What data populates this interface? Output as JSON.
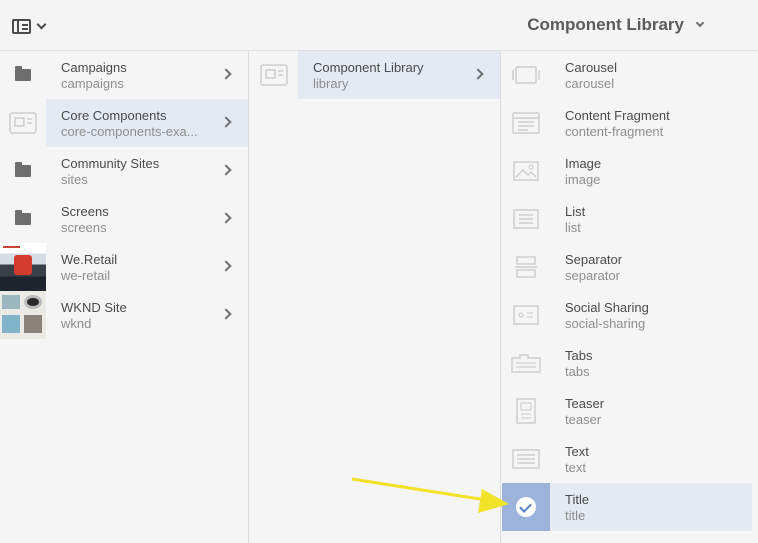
{
  "header": {
    "title": "Component Library",
    "rail_toggle_icon": "rail-toggle-icon",
    "title_menu_icon": "chevron-down-icon"
  },
  "columns": {
    "sites": [
      {
        "title": "Campaigns",
        "name": "campaigns",
        "thumb": "folder-icon",
        "selected": false
      },
      {
        "title": "Core Components",
        "name": "core-components-exa...",
        "thumb": "component-icon",
        "selected": true
      },
      {
        "title": "Community Sites",
        "name": "sites",
        "thumb": "folder-icon",
        "selected": false
      },
      {
        "title": "Screens",
        "name": "screens",
        "thumb": "folder-icon",
        "selected": false
      },
      {
        "title": "We.Retail",
        "name": "we-retail",
        "thumb": "we-retail-thumbnail",
        "selected": false
      },
      {
        "title": "WKND Site",
        "name": "wknd",
        "thumb": "wknd-thumbnail",
        "selected": false
      }
    ],
    "library": [
      {
        "title": "Component Library",
        "name": "library",
        "thumb": "component-icon",
        "selected": true
      }
    ],
    "components": [
      {
        "title": "Carousel",
        "name": "carousel",
        "thumb": "carousel-icon",
        "selected": false
      },
      {
        "title": "Content Fragment",
        "name": "content-fragment",
        "thumb": "content-fragment-icon",
        "selected": false
      },
      {
        "title": "Image",
        "name": "image",
        "thumb": "image-icon",
        "selected": false
      },
      {
        "title": "List",
        "name": "list",
        "thumb": "list-icon",
        "selected": false
      },
      {
        "title": "Separator",
        "name": "separator",
        "thumb": "separator-icon",
        "selected": false
      },
      {
        "title": "Social Sharing",
        "name": "social-sharing",
        "thumb": "social-sharing-icon",
        "selected": false
      },
      {
        "title": "Tabs",
        "name": "tabs",
        "thumb": "tabs-icon",
        "selected": false
      },
      {
        "title": "Teaser",
        "name": "teaser",
        "thumb": "teaser-icon",
        "selected": false
      },
      {
        "title": "Text",
        "name": "text",
        "thumb": "text-icon",
        "selected": false
      },
      {
        "title": "Title",
        "name": "title",
        "thumb": "checkmark-icon",
        "selected": true
      }
    ]
  },
  "colors": {
    "selected_row": "#e4e9f2",
    "selected_thumb": "#9cb4dc",
    "annotation_arrow": "#f2e22a"
  }
}
